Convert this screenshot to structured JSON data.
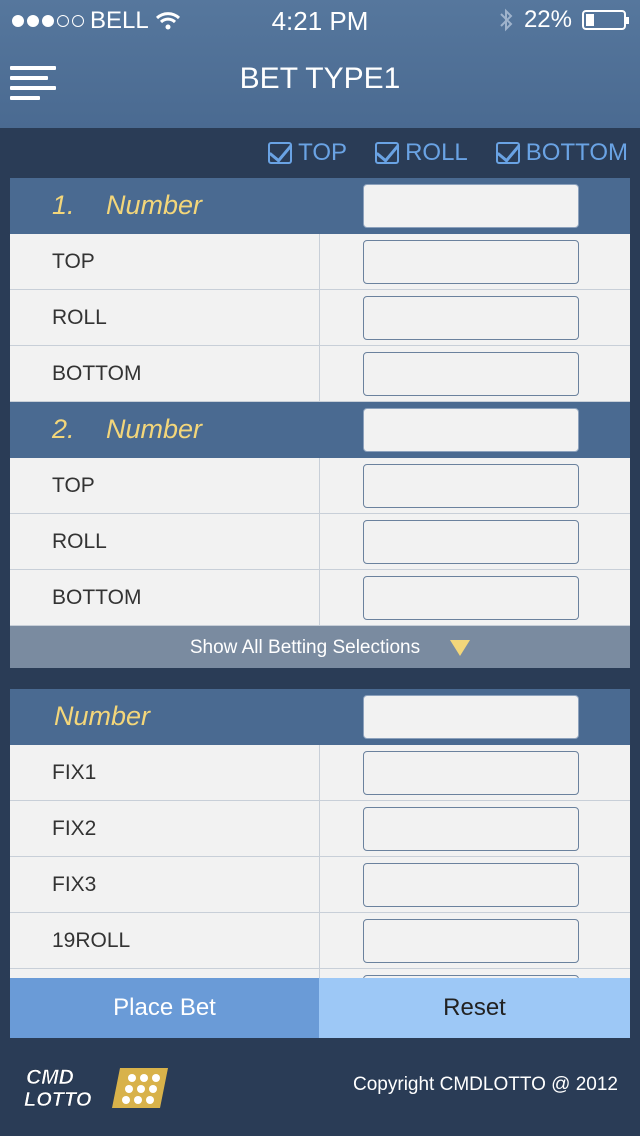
{
  "status": {
    "carrier": "BELL",
    "time": "4:21 PM",
    "battery": "22%",
    "signal_bars": 3,
    "signal_total": 5,
    "battery_level": 0.22
  },
  "header": {
    "title": "BET TYPE1",
    "menu_icon": "hamburger-menu-icon"
  },
  "filters": [
    {
      "label": "TOP",
      "checked": true
    },
    {
      "label": "ROLL",
      "checked": true
    },
    {
      "label": "BOTTOM",
      "checked": true
    }
  ],
  "entry1": {
    "index": "1.",
    "label": "Number",
    "number_value": "",
    "rows": [
      {
        "label": "TOP",
        "value": ""
      },
      {
        "label": "ROLL",
        "value": ""
      },
      {
        "label": "BOTTOM",
        "value": ""
      }
    ]
  },
  "entry2": {
    "index": "2.",
    "label": "Number",
    "number_value": "",
    "rows": [
      {
        "label": "TOP",
        "value": ""
      },
      {
        "label": "ROLL",
        "value": ""
      },
      {
        "label": "BOTTOM",
        "value": ""
      }
    ]
  },
  "show_all": {
    "label": "Show All Betting Selections"
  },
  "entry3": {
    "label": "Number",
    "number_value": "",
    "rows": [
      {
        "label": "FIX1",
        "value": ""
      },
      {
        "label": "FIX2",
        "value": ""
      },
      {
        "label": "FIX3",
        "value": ""
      },
      {
        "label": "19ROLL",
        "value": ""
      }
    ]
  },
  "actions": {
    "place_bet": "Place Bet",
    "reset": "Reset"
  },
  "footer": {
    "logo_line1": "CMD",
    "logo_line2": "LOTTO",
    "copyright": "Copyright CMDLOTTO @ 2012"
  },
  "colors": {
    "header_bg": "#4a6a91",
    "accent_yellow": "#f3d67a",
    "check_blue": "#6aa3e4",
    "place_bet_bg": "#6a9bd7",
    "reset_bg": "#9dc8f6"
  }
}
